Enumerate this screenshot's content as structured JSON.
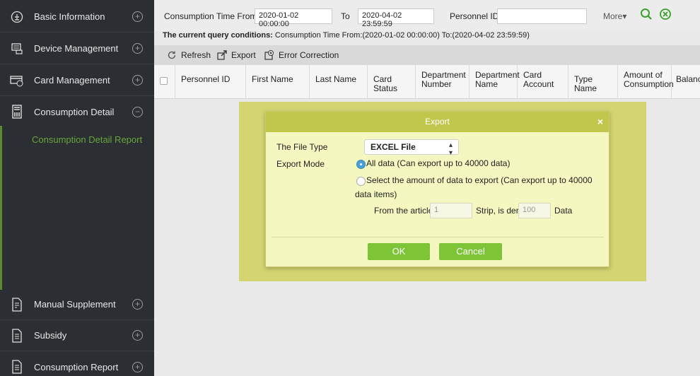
{
  "sidebar": {
    "items": [
      {
        "label": "Basic Information",
        "toggle": "+"
      },
      {
        "label": "Device Management",
        "toggle": "+"
      },
      {
        "label": "Card Management",
        "toggle": "+"
      },
      {
        "label": "Consumption Detail",
        "toggle": "−"
      },
      {
        "label": "Manual Supplement",
        "toggle": "+"
      },
      {
        "label": "Subsidy",
        "toggle": "+"
      },
      {
        "label": "Consumption Report",
        "toggle": "+"
      }
    ],
    "subitem": "Consumption Detail Report"
  },
  "search": {
    "time_from_label": "Consumption Time From",
    "time_from_value": "2020-01-02 00:00:00",
    "to_label": "To",
    "to_value": "2020-04-02 23:59:59",
    "personnel_label": "Personnel ID",
    "personnel_value": "",
    "more_label": "More▾"
  },
  "query": {
    "bold": "The current query conditions:",
    "text": " Consumption Time From:(2020-01-02 00:00:00)  To:(2020-04-02 23:59:59)"
  },
  "toolbar": {
    "refresh_label": "Refresh",
    "export_label": "Export",
    "error_label": "Error Correction"
  },
  "table": {
    "headers": [
      "Personnel ID",
      "First Name",
      "Last Name",
      "Card Status",
      "Department Number",
      "Department Name",
      "Card Account",
      "Type Name",
      "Amount of Consumption",
      "Balance"
    ]
  },
  "dialog": {
    "title": "Export",
    "close": "×",
    "file_type_label": "The File Type",
    "file_type_value": "EXCEL File",
    "export_mode_label": "Export Mode",
    "option_all": "All data (Can export up to 40000 data)",
    "option_select": "Select the amount of data to export (Can export up to 40000 data items)",
    "from_label": "From the article",
    "from_value": "1",
    "strip_label": "Strip, is derived",
    "strip_value": "100",
    "data_label": "Data",
    "ok_label": "OK",
    "cancel_label": "Cancel"
  },
  "colors": {
    "accent_green": "#3aa02c",
    "button_green": "#7dc436",
    "sidebar_bg": "#2b2e33",
    "dialog_title": "#c1c64c"
  }
}
